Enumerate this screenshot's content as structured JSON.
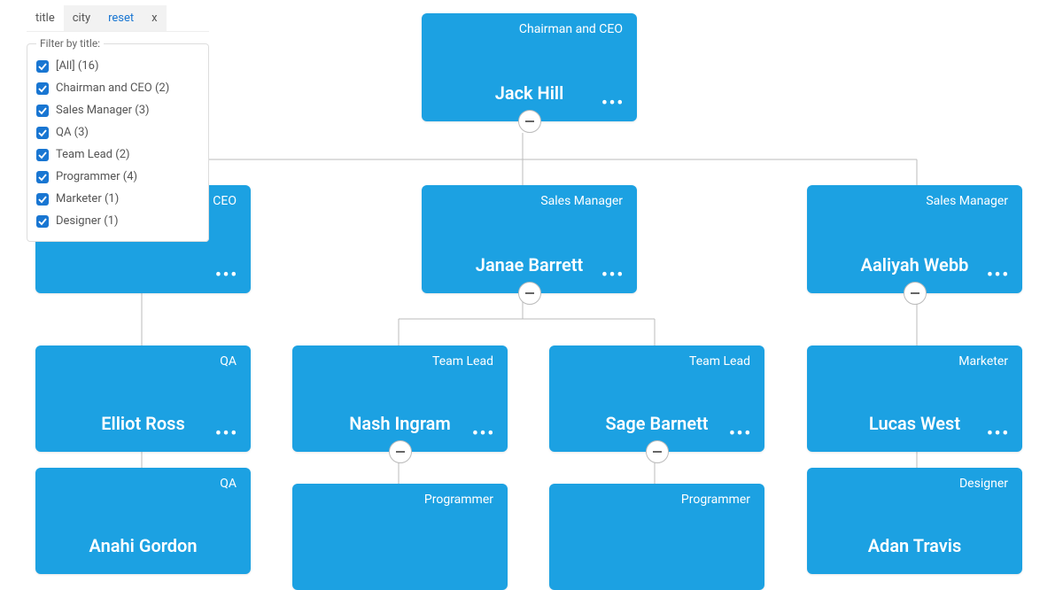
{
  "filter": {
    "tabs": {
      "title": "title",
      "city": "city",
      "reset": "reset",
      "x": "x"
    },
    "legend": "Filter by title:",
    "options": [
      {
        "label": "[All] (16)"
      },
      {
        "label": "Chairman and CEO (2)"
      },
      {
        "label": "Sales Manager (3)"
      },
      {
        "label": "QA (3)"
      },
      {
        "label": "Team Lead (2)"
      },
      {
        "label": "Programmer (4)"
      },
      {
        "label": "Marketer (1)"
      },
      {
        "label": "Designer (1)"
      }
    ]
  },
  "nodes": {
    "root": {
      "role": "Chairman and CEO",
      "name": "Jack Hill"
    },
    "leftCeo": {
      "role": "CEO",
      "name": ""
    },
    "janae": {
      "role": "Sales Manager",
      "name": "Janae Barrett"
    },
    "aaliyah": {
      "role": "Sales Manager",
      "name": "Aaliyah Webb"
    },
    "elliot": {
      "role": "QA",
      "name": "Elliot Ross"
    },
    "anahi": {
      "role": "QA",
      "name": "Anahi Gordon"
    },
    "nash": {
      "role": "Team Lead",
      "name": "Nash Ingram"
    },
    "sage": {
      "role": "Team Lead",
      "name": "Sage Barnett"
    },
    "lucas": {
      "role": "Marketer",
      "name": "Lucas West"
    },
    "adan": {
      "role": "Designer",
      "name": "Adan Travis"
    },
    "prog1": {
      "role": "Programmer",
      "name": ""
    },
    "prog2": {
      "role": "Programmer",
      "name": ""
    }
  },
  "dots": "•••"
}
